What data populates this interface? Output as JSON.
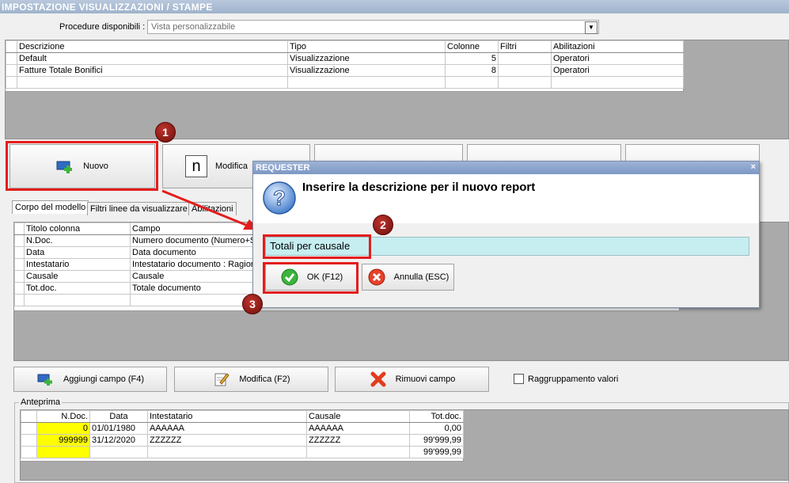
{
  "window": {
    "title": "IMPOSTAZIONE VISUALIZZAZIONI / STAMPE"
  },
  "procedures": {
    "label": "Procedure disponibili :",
    "value": "Vista personalizzabile"
  },
  "reports_grid": {
    "headers": [
      "Descrizione",
      "Tipo",
      "Colonne",
      "Filtri",
      "Abilitazioni"
    ],
    "rows": [
      [
        "Default",
        "Visualizzazione",
        "5",
        "",
        "Operatori"
      ],
      [
        "Fatture Totale Bonifici",
        "Visualizzazione",
        "8",
        "",
        "Operatori"
      ]
    ]
  },
  "toolbar": {
    "nuovo": "Nuovo",
    "modifica": "Modifica"
  },
  "tabs": [
    "Corpo del modello",
    "Filtri linee da visualizzare",
    "Abilitazioni"
  ],
  "fields_grid": {
    "headers": [
      "Titolo colonna",
      "Campo"
    ],
    "rows": [
      [
        "N.Doc.",
        "Numero documento (Numero+Se"
      ],
      [
        "Data",
        "Data documento"
      ],
      [
        "Intestatario",
        "Intestatario documento : Ragior"
      ],
      [
        "Causale",
        "Causale"
      ],
      [
        "Tot.doc.",
        "Totale documento"
      ]
    ]
  },
  "field_buttons": {
    "aggiungi": "Aggiungi campo (F4)",
    "modifica": "Modifica (F2)",
    "rimuovi": "Rimuovi campo",
    "raggruppamento": "Raggruppamento valori"
  },
  "preview": {
    "label": "Anteprima",
    "headers": [
      "N.Doc.",
      "Data",
      "Intestatario",
      "Causale",
      "Tot.doc."
    ],
    "rows": [
      [
        "0",
        "01/01/1980",
        "AAAAAA",
        "AAAAAA",
        "0,00"
      ],
      [
        "999999",
        "31/12/2020",
        "ZZZZZZ",
        "ZZZZZZ",
        "99'999,99"
      ],
      [
        "",
        "",
        "",
        "",
        "99'999,99"
      ]
    ]
  },
  "dialog": {
    "title": "REQUESTER",
    "close": "×",
    "prompt": "Inserire la descrizione per il nuovo report",
    "input_value": "Totali per causale",
    "ok": "OK (F12)",
    "cancel": "Annulla (ESC)"
  },
  "steps": [
    "1",
    "2",
    "3"
  ],
  "colors": {
    "highlight": "#e31d1d",
    "input_bg": "#c6eef1",
    "key_cell": "#ffff00"
  },
  "icons": [
    "add-record-icon",
    "n-letter-icon",
    "question-icon",
    "ok-check-icon",
    "cancel-x-icon",
    "edit-pencil-icon",
    "remove-x-icon"
  ]
}
